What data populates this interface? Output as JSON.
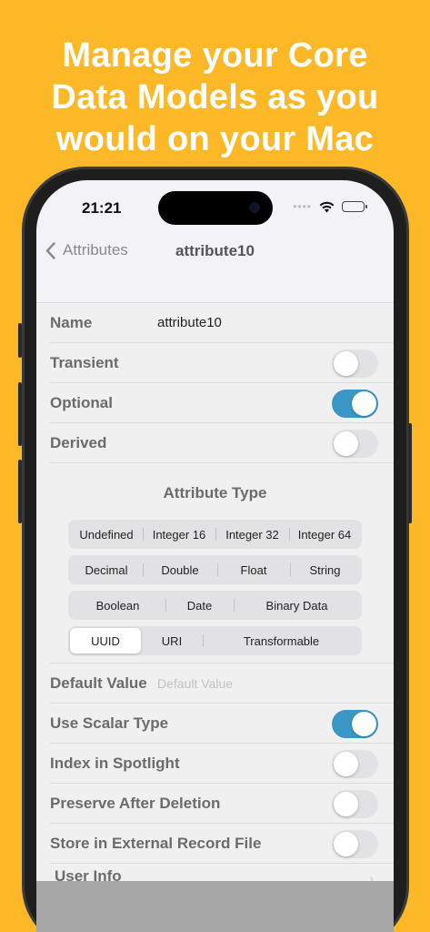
{
  "headline": {
    "line1": "Manage your Core",
    "line2": "Data Models as you",
    "line3": "would on your Mac"
  },
  "status_bar": {
    "time": "21:21"
  },
  "nav": {
    "back_label": "Attributes",
    "title": "attribute10"
  },
  "form": {
    "name_label": "Name",
    "name_value": "attribute10",
    "transient": {
      "label": "Transient",
      "on": false
    },
    "optional": {
      "label": "Optional",
      "on": true
    },
    "derived": {
      "label": "Derived",
      "on": false
    }
  },
  "attribute_type": {
    "title": "Attribute Type",
    "row1": [
      "Undefined",
      "Integer 16",
      "Integer 32",
      "Integer 64"
    ],
    "row2": [
      "Decimal",
      "Double",
      "Float",
      "String"
    ],
    "row3": [
      "Boolean",
      "Date",
      "Binary Data"
    ],
    "row4": [
      "UUID",
      "URI",
      "Transformable"
    ],
    "selected": "UUID"
  },
  "default_value": {
    "label": "Default Value",
    "placeholder": "Default Value"
  },
  "options": {
    "use_scalar_type": {
      "label": "Use Scalar Type",
      "on": true
    },
    "index_in_spotlight": {
      "label": "Index in Spotlight",
      "on": false
    },
    "preserve_after_deletion": {
      "label": "Preserve After Deletion",
      "on": false
    },
    "store_in_external_record_file": {
      "label": "Store in External Record File",
      "on": false
    }
  },
  "user_info": {
    "label": "User Info"
  },
  "colors": {
    "background": "#FDB827",
    "toggle_on": "#3b97c6",
    "toggle_off": "#e2e2e4"
  },
  "icons": [
    "chevron-left-icon",
    "wifi-icon",
    "battery-icon",
    "chevron-right-icon"
  ]
}
